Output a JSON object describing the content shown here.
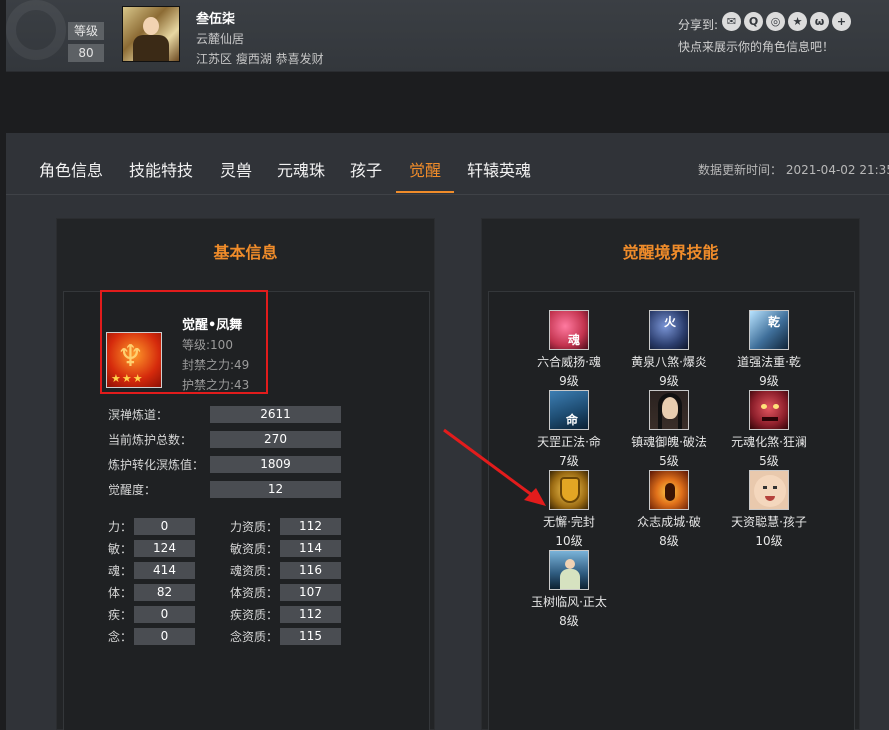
{
  "profile": {
    "level_label": "等级",
    "level_value": "80",
    "name": "叁伍柒",
    "server": "云麓仙居",
    "region": "江苏区 瘦西湖 恭喜发财",
    "share_label": "分享到:",
    "share_tip": "快点来展示你的角色信息吧！",
    "share_icons": [
      "wechat-icon",
      "qq-icon",
      "weibo-icon",
      "qzone-icon",
      "tieba-icon",
      "more-icon"
    ]
  },
  "tabs": [
    "角色信息",
    "技能特技",
    "灵兽",
    "元魂珠",
    "孩子",
    "觉醒",
    "轩辕英魂"
  ],
  "active_tab": "觉醒",
  "update_time": "数据更新时间： 2021-04-02 21:35",
  "basic": {
    "title": "基本信息",
    "awaken_name": "觉醒•凤舞",
    "level": "等级:100",
    "seal_power": "封禁之力:49",
    "guard_power": "护禁之力:43",
    "rows": [
      {
        "label": "溟禅炼道：",
        "value": "2611"
      },
      {
        "label": "当前炼护总数：",
        "value": "270"
      },
      {
        "label": "炼护转化溟炼值：",
        "value": "1809"
      },
      {
        "label": "觉醒度：",
        "value": "12"
      }
    ],
    "attrs": [
      {
        "label": "力：",
        "value": "0",
        "q_label": "力资质：",
        "q_value": "112"
      },
      {
        "label": "敏：",
        "value": "124",
        "q_label": "敏资质：",
        "q_value": "114"
      },
      {
        "label": "魂：",
        "value": "414",
        "q_label": "魂资质：",
        "q_value": "116"
      },
      {
        "label": "体：",
        "value": "82",
        "q_label": "体资质：",
        "q_value": "107"
      },
      {
        "label": "疾：",
        "value": "0",
        "q_label": "疾资质：",
        "q_value": "112"
      },
      {
        "label": "念：",
        "value": "0",
        "q_label": "念资质：",
        "q_value": "115"
      }
    ]
  },
  "skills": {
    "title": "觉醒境界技能",
    "items": [
      {
        "name": "六合威扬·魂",
        "level": "9级",
        "glyph": "魂",
        "color": "#c2334e"
      },
      {
        "name": "黄泉八煞·爆炎",
        "level": "9级",
        "glyph": "火",
        "color": "#2c3e6e"
      },
      {
        "name": "道强法重·乾",
        "level": "9级",
        "glyph": "乾",
        "color": "#3f6f9a"
      },
      {
        "name": "天罡正法·命",
        "level": "7级",
        "glyph": "命",
        "color": "#1e4d73"
      },
      {
        "name": "镇魂御魄·破法",
        "level": "5级",
        "glyph": "",
        "color": "#3a2e28"
      },
      {
        "name": "元魂化煞·狂澜",
        "level": "5级",
        "glyph": "",
        "color": "#8d1f2b"
      },
      {
        "name": "无懈·完封",
        "level": "10级",
        "glyph": "",
        "color": "#9a6a12"
      },
      {
        "name": "众志成城·破",
        "level": "8级",
        "glyph": "",
        "color": "#b3470f"
      },
      {
        "name": "天资聪慧·孩子",
        "level": "10级",
        "glyph": "",
        "color": "#e9c9ad"
      },
      {
        "name": "玉树临风·正太",
        "level": "8级",
        "glyph": "",
        "color": "#2e5a7e"
      }
    ]
  }
}
